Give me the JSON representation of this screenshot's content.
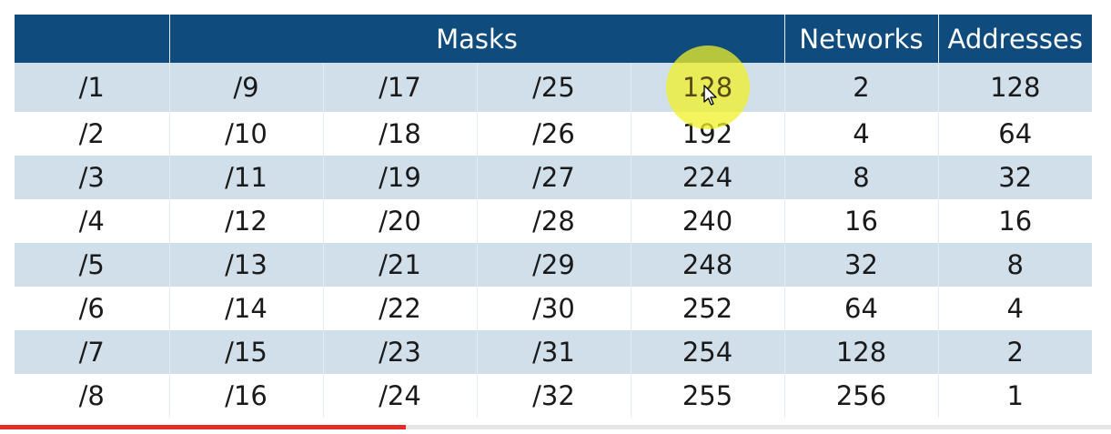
{
  "table": {
    "headers": [
      "",
      "Masks",
      "Networks",
      "Addresses"
    ],
    "rows": [
      [
        "/1",
        "/9",
        "/17",
        "/25",
        "128",
        "2",
        "128"
      ],
      [
        "/2",
        "/10",
        "/18",
        "/26",
        "192",
        "4",
        "64"
      ],
      [
        "/3",
        "/11",
        "/19",
        "/27",
        "224",
        "8",
        "32"
      ],
      [
        "/4",
        "/12",
        "/20",
        "/28",
        "240",
        "16",
        "16"
      ],
      [
        "/5",
        "/13",
        "/21",
        "/29",
        "248",
        "32",
        "8"
      ],
      [
        "/6",
        "/14",
        "/22",
        "/30",
        "252",
        "64",
        "4"
      ],
      [
        "/7",
        "/15",
        "/23",
        "/31",
        "254",
        "128",
        "2"
      ],
      [
        "/8",
        "/16",
        "/24",
        "/32",
        "255",
        "256",
        "1"
      ]
    ]
  },
  "colors": {
    "header_bg": "#0f4c7d",
    "row_alt_bg": "#d1dfea",
    "highlight": "#f0f028",
    "progress": "#e52d27"
  },
  "video_progress": 0.365,
  "icons": [
    "mouse-pointer-icon"
  ]
}
